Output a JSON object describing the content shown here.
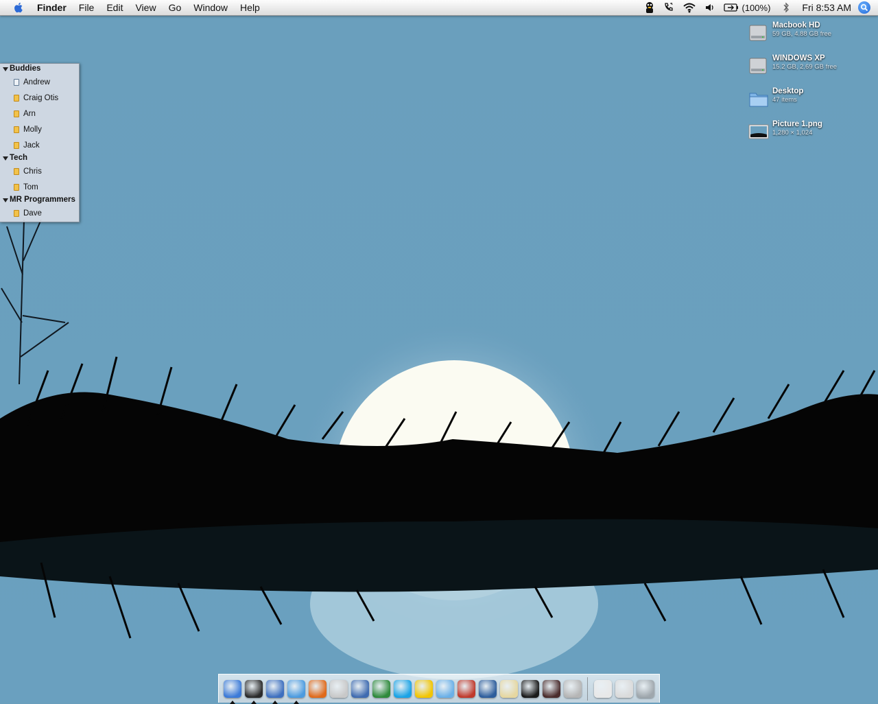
{
  "menubar": {
    "apple_icon": "apple-icon",
    "app_name": "Finder",
    "menus": [
      "File",
      "Edit",
      "View",
      "Go",
      "Window",
      "Help"
    ],
    "status_items": [
      "adium-duck-icon",
      "phone-icon",
      "wifi-icon",
      "volume-icon",
      "battery-icon",
      "bluetooth-icon"
    ],
    "battery_text": "(100%)",
    "clock": "Fri 8:53 AM",
    "spotlight_icon": "spotlight-icon"
  },
  "buddy_list": {
    "groups": [
      {
        "name": "Buddies",
        "buddies": [
          "Andrew",
          "Craig Otis",
          "Arn",
          "Molly",
          "Jack"
        ]
      },
      {
        "name": "Tech",
        "buddies": [
          "Chris",
          "Tom"
        ]
      },
      {
        "name": "MR Programmers",
        "buddies": [
          "Dave"
        ]
      }
    ]
  },
  "desktop_icons": [
    {
      "name": "Macbook HD",
      "info": "59 GB, 4.88 GB free",
      "icon": "hard-drive-icon"
    },
    {
      "name": "WINDOWS XP",
      "info": "15.2 GB, 2.69 GB free",
      "icon": "hard-drive-icon"
    },
    {
      "name": "Desktop",
      "info": "47 items",
      "icon": "folder-icon"
    },
    {
      "name": "Picture 1.png",
      "info": "1,280 × 1,024",
      "icon": "image-file-icon"
    }
  ],
  "dock": {
    "apps": [
      {
        "icon": "finder-icon",
        "color": "#3b7ad8",
        "running": true
      },
      {
        "icon": "dashboard-icon",
        "color": "#2a2a2a",
        "running": true
      },
      {
        "icon": "adium-icon",
        "color": "#3d6fbf",
        "running": true
      },
      {
        "icon": "safari-icon",
        "color": "#4b9be0",
        "running": true
      },
      {
        "icon": "firefox-icon",
        "color": "#e06a1b",
        "running": false
      },
      {
        "icon": "script-editor-icon",
        "color": "#c8c8c8",
        "running": false
      },
      {
        "icon": "preview-icon",
        "color": "#3f6bb0",
        "running": false
      },
      {
        "icon": "network-globe-icon",
        "color": "#2f8a3c",
        "running": false
      },
      {
        "icon": "skype-icon",
        "color": "#19a3e6",
        "running": false
      },
      {
        "icon": "cyberduck-icon",
        "color": "#f2c500",
        "running": false
      },
      {
        "icon": "itunes-icon",
        "color": "#6ab0e8",
        "running": false
      },
      {
        "icon": "vmware-icon",
        "color": "#c0392b",
        "running": false
      },
      {
        "icon": "xcode-icon",
        "color": "#2d5d9c",
        "running": false
      },
      {
        "icon": "textedit-icon",
        "color": "#e6d7a0",
        "running": false
      },
      {
        "icon": "terminal-icon",
        "color": "#1a1a1a",
        "running": false
      },
      {
        "icon": "photo-booth-icon",
        "color": "#4a2c2c",
        "running": false
      },
      {
        "icon": "system-preferences-icon",
        "color": "#b5b5b5",
        "running": false
      }
    ],
    "docs": [
      {
        "icon": "document-icon",
        "color": "#e8e8e8"
      },
      {
        "icon": "printer-icon",
        "color": "#dadada"
      },
      {
        "icon": "trash-icon",
        "color": "#9fa7ad"
      }
    ]
  }
}
